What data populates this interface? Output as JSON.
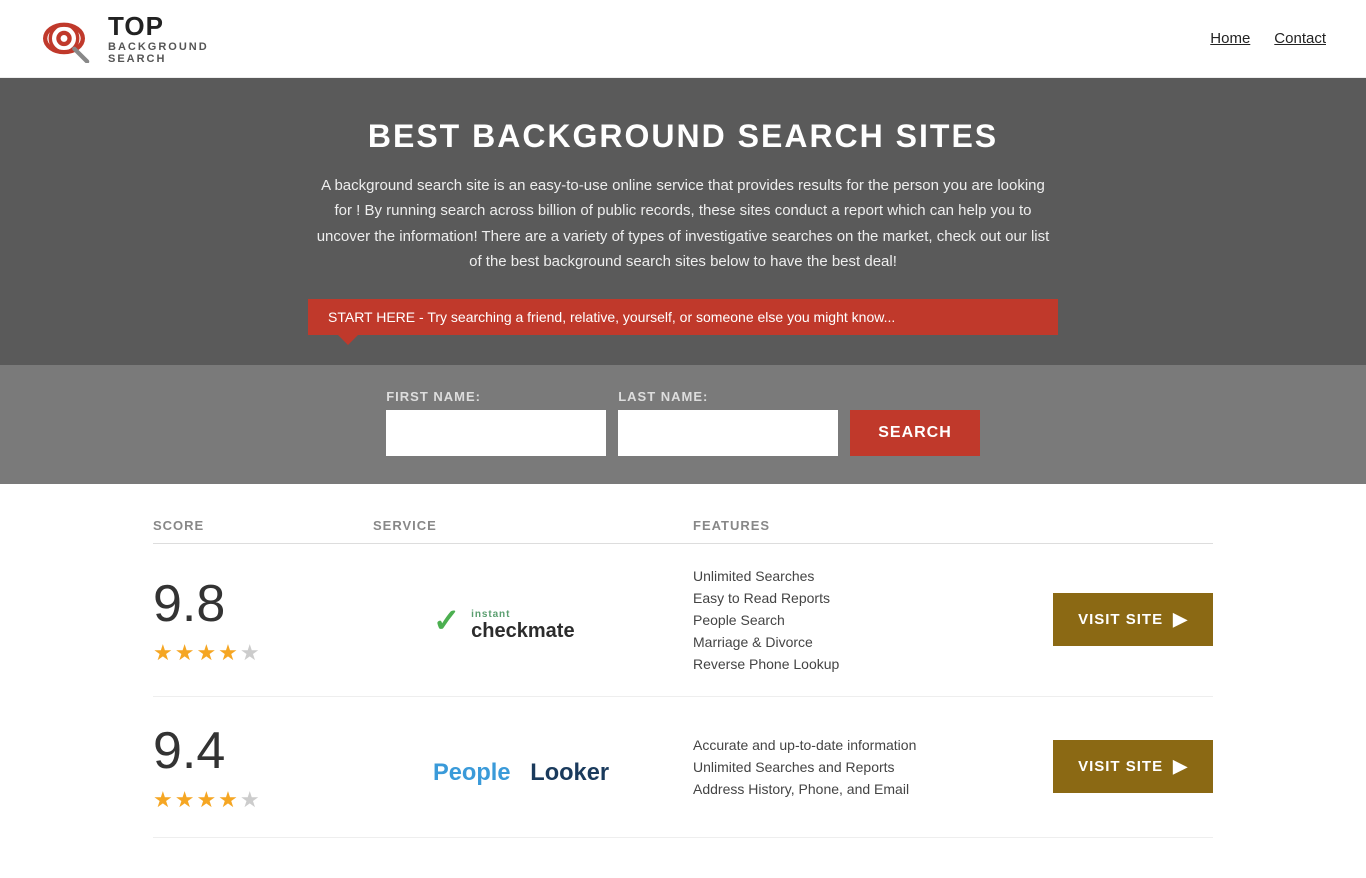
{
  "header": {
    "logo_top": "TOP",
    "logo_sub": "BACKGROUND\nSEARCH",
    "nav": [
      {
        "label": "Home",
        "href": "#"
      },
      {
        "label": "Contact",
        "href": "#"
      }
    ]
  },
  "hero": {
    "title": "BEST BACKGROUND SEARCH SITES",
    "description": "A background search site is an easy-to-use online service that provides results  for the person you are looking for ! By  running  search across billion of public records, these sites conduct  a report which can help you to uncover the information! There are a variety of types of investigative searches on the market, check out our  list of the best background search sites below to have the best deal!",
    "callout": "START HERE - Try searching a friend, relative, yourself, or someone else you might know..."
  },
  "search_form": {
    "first_name_label": "FIRST NAME:",
    "last_name_label": "LAST NAME:",
    "button_label": "SEARCH"
  },
  "table": {
    "headers": {
      "score": "SCORE",
      "service": "SERVICE",
      "features": "FEATURES",
      "action": ""
    },
    "rows": [
      {
        "score": "9.8",
        "stars": "★★★★★",
        "service_name": "Instant Checkmate",
        "service_type": "checkmate",
        "features": [
          "Unlimited Searches",
          "Easy to Read Reports",
          "People Search",
          "Marriage & Divorce",
          "Reverse Phone Lookup"
        ],
        "visit_label": "VISIT SITE"
      },
      {
        "score": "9.4",
        "stars": "★★★★★",
        "service_name": "PeopleLooker",
        "service_type": "peoplelooker",
        "features": [
          "Accurate and up-to-date information",
          "Unlimited Searches and Reports",
          "Address History, Phone, and Email"
        ],
        "visit_label": "VISIT SITE"
      }
    ]
  },
  "colors": {
    "accent_red": "#c0392b",
    "accent_gold": "#8B6914",
    "star_color": "#f5a623",
    "hero_bg": "#5a5a5a",
    "search_bg": "#7a7a7a"
  }
}
